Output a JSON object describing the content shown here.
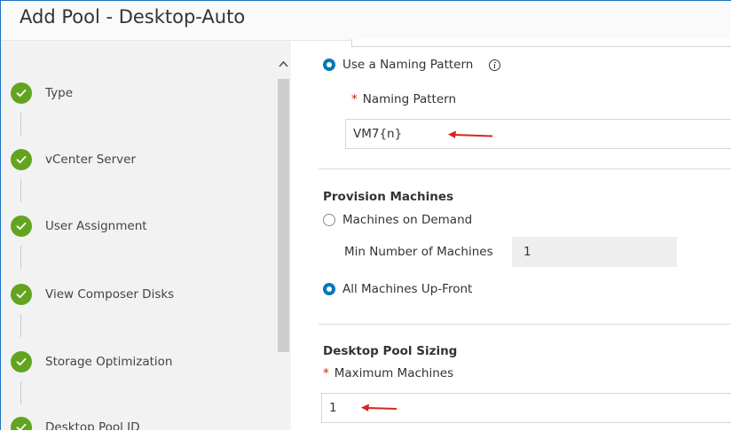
{
  "window": {
    "title": "Add Pool - Desktop-Auto"
  },
  "sidebar": {
    "steps": [
      {
        "label": "Type",
        "status": "complete"
      },
      {
        "label": "vCenter Server",
        "status": "complete"
      },
      {
        "label": "User Assignment",
        "status": "complete"
      },
      {
        "label": "View Composer Disks",
        "status": "complete"
      },
      {
        "label": "Storage Optimization",
        "status": "complete"
      },
      {
        "label": "Desktop Pool ID",
        "status": "complete"
      }
    ],
    "check_color": "#62a420"
  },
  "naming": {
    "use_pattern_label": "Use a Naming Pattern",
    "use_pattern_selected": true,
    "pattern_label": "Naming Pattern",
    "pattern_value": "VM7{n}"
  },
  "provision": {
    "section_title": "Provision Machines",
    "on_demand_label": "Machines on Demand",
    "on_demand_selected": false,
    "min_machines_label": "Min Number of Machines",
    "min_machines_value": "1",
    "up_front_label": "All Machines Up-Front",
    "up_front_selected": true
  },
  "sizing": {
    "section_title": "Desktop Pool Sizing",
    "max_machines_label": "Maximum Machines",
    "max_machines_value": "1"
  },
  "required_marker": "*",
  "colors": {
    "accent": "#0079b8",
    "required": "#c92100",
    "annotation_arrow": "#d9261c",
    "window_border": "#1e73c7"
  }
}
